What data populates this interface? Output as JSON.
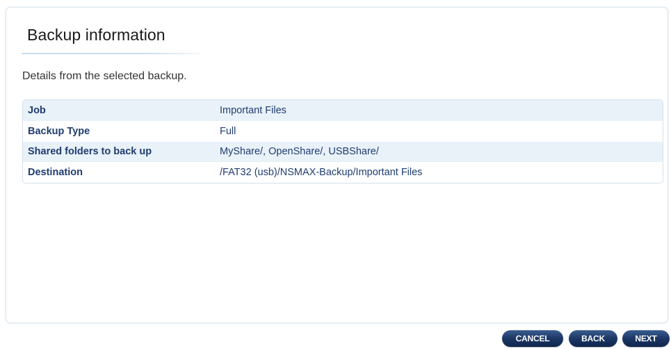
{
  "page": {
    "title": "Backup information",
    "subtitle": "Details from the selected backup."
  },
  "details": [
    {
      "label": "Job",
      "value": "Important Files"
    },
    {
      "label": "Backup Type",
      "value": "Full"
    },
    {
      "label": "Shared folders to back up",
      "value": "MyShare/, OpenShare/, USBShare/"
    },
    {
      "label": "Destination",
      "value": "/FAT32 (usb)/NSMAX-Backup/Important Files"
    }
  ],
  "buttons": {
    "cancel": "CANCEL",
    "back": "BACK",
    "next": "NEXT"
  },
  "colors": {
    "row_alt_background": "#e9f1f9",
    "text_blue": "#1f3d6e",
    "button_navy": "#1c3765",
    "border": "#d4e1ee"
  }
}
